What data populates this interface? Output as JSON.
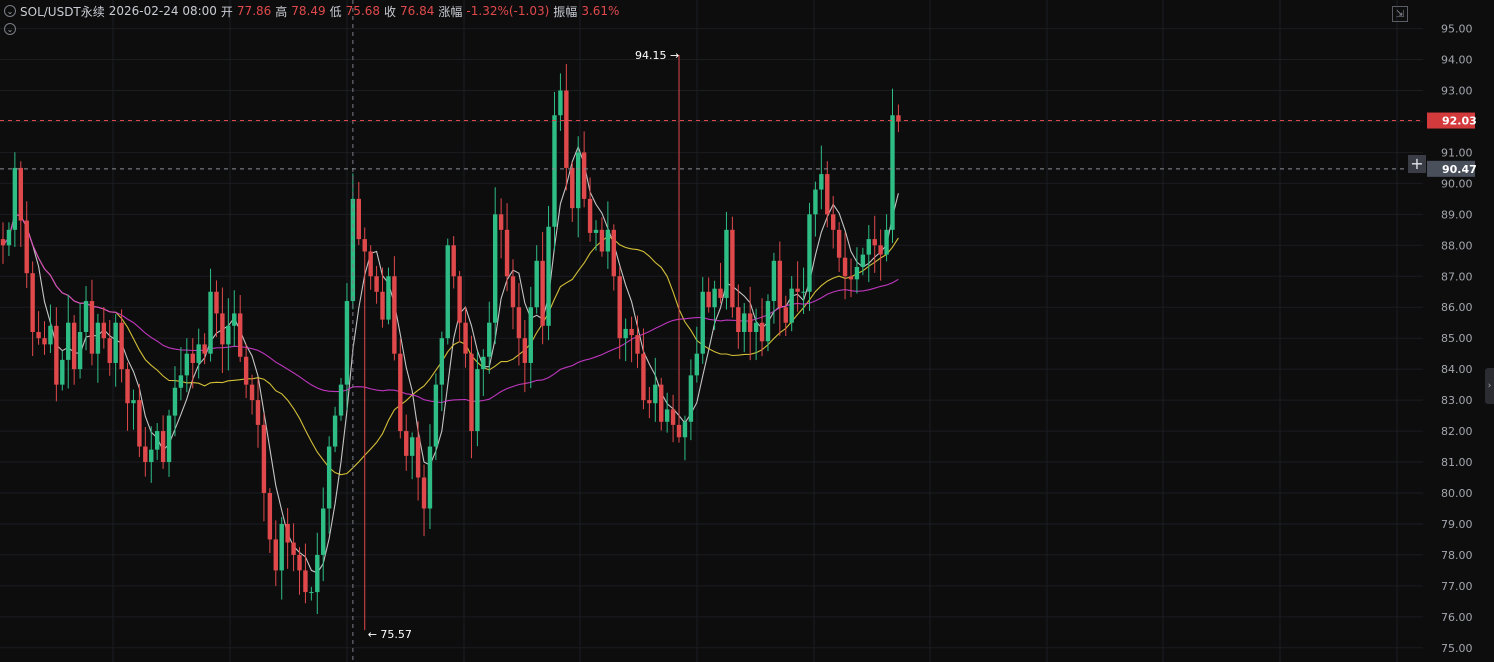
{
  "header": {
    "symbol": "SOL/USDT永续",
    "datetime": "2026-02-24 08:00",
    "open_label": "开",
    "open_value": "77.86",
    "high_label": "高",
    "high_value": "78.49",
    "low_label": "低",
    "low_value": "75.68",
    "close_label": "收",
    "close_value": "76.84",
    "change_label": "涨幅",
    "change_value": "-1.32%(-1.03)",
    "amplitude_label": "振幅",
    "amplitude_value": "3.61%"
  },
  "colors": {
    "background": "#0d0d0e",
    "up": "#2ebd85",
    "down": "#e0494b",
    "ma_fast": "#d8d8d8",
    "ma_mid": "#e8d23c",
    "ma_slow": "#d13bd1",
    "grid": "#1c1d21",
    "axis_text": "#a3a6ad"
  },
  "chart_data": {
    "type": "candlestick",
    "ylim": [
      74.8,
      95.6
    ],
    "y_ticks": [
      "95.00",
      "94.00",
      "93.00",
      "92.00",
      "91.00",
      "90.00",
      "89.00",
      "88.00",
      "87.00",
      "86.00",
      "85.00",
      "84.00",
      "83.00",
      "82.00",
      "81.00",
      "80.00",
      "79.00",
      "78.00",
      "77.00",
      "76.00",
      "75.00"
    ],
    "price_markers": [
      {
        "label": "92.03",
        "value": 92.03,
        "kind": "last-price"
      },
      {
        "label": "90.47",
        "value": 90.47,
        "kind": "crosshair"
      }
    ],
    "annotations": [
      {
        "label": "94.15",
        "value": 94.15,
        "candle": 114,
        "direction": "right"
      },
      {
        "label": "75.57",
        "value": 75.57,
        "candle": 61,
        "direction": "left"
      }
    ],
    "crosshair_candle": 59,
    "closes": [
      88.0,
      88.5,
      90.5,
      88.8,
      87.1,
      85.2,
      85.0,
      84.8,
      85.4,
      83.5,
      84.3,
      85.5,
      84.0,
      85.2,
      86.2,
      84.5,
      85.5,
      85.0,
      84.2,
      85.5,
      84.0,
      82.9,
      83.0,
      81.5,
      81.0,
      81.4,
      82.0,
      81.0,
      82.5,
      83.4,
      83.8,
      84.5,
      84.2,
      84.8,
      84.5,
      86.5,
      85.8,
      84.8,
      85.4,
      85.8,
      84.4,
      83.5,
      83.0,
      82.2,
      80.0,
      78.5,
      77.5,
      79.0,
      78.4,
      78.0,
      77.5,
      76.8,
      76.8,
      78.0,
      79.5,
      81.5,
      82.5,
      83.5,
      86.2,
      89.5,
      88.2,
      87.8,
      87.0,
      86.5,
      85.6,
      87.0,
      84.5,
      82.0,
      81.2,
      81.8,
      80.5,
      79.5,
      81.5,
      83.5,
      85.0,
      88.0,
      87.0,
      85.5,
      84.5,
      82.0,
      84.0,
      84.4,
      85.5,
      89.0,
      88.5,
      87.0,
      86.0,
      85.0,
      84.2,
      86.0,
      87.5,
      85.4,
      88.6,
      92.2,
      93.0,
      90.5,
      89.2,
      91.0,
      89.5,
      88.4,
      88.5,
      87.8,
      88.5,
      87.0,
      85.0,
      85.3,
      85.1,
      84.5,
      83.0,
      82.9,
      83.5,
      82.3,
      82.7,
      82.2,
      81.8,
      82.3,
      83.8,
      84.5,
      86.5,
      86.0,
      86.6,
      86.3,
      88.5,
      86.0,
      85.2,
      85.8,
      85.2,
      85.5,
      84.9,
      86.2,
      87.5,
      86.0,
      85.5,
      86.6,
      86.5,
      86.5,
      89.0,
      89.8,
      90.3,
      89.0,
      88.5,
      87.6,
      87.0,
      86.9,
      87.3,
      87.7,
      88.2,
      88.0,
      87.7,
      88.5,
      92.2,
      92.0
    ],
    "opens": [
      88.2,
      88.0,
      88.5,
      90.5,
      88.8,
      87.1,
      85.2,
      85.0,
      84.8,
      85.4,
      83.5,
      84.3,
      85.5,
      84.0,
      85.2,
      86.2,
      84.5,
      85.5,
      85.0,
      84.2,
      85.5,
      84.0,
      82.9,
      83.0,
      81.5,
      81.0,
      81.4,
      82.0,
      81.0,
      82.5,
      83.4,
      83.8,
      84.5,
      84.2,
      84.8,
      84.5,
      86.5,
      85.8,
      84.8,
      85.4,
      85.8,
      84.4,
      83.5,
      83.0,
      82.2,
      80.0,
      78.5,
      77.5,
      79.0,
      78.4,
      78.0,
      77.5,
      76.8,
      76.8,
      78.0,
      79.5,
      81.5,
      82.5,
      83.5,
      86.2,
      89.5,
      88.2,
      87.8,
      87.0,
      86.5,
      85.6,
      87.0,
      84.5,
      82.0,
      81.2,
      81.8,
      80.5,
      79.5,
      81.5,
      83.5,
      85.0,
      88.0,
      87.0,
      85.5,
      84.5,
      82.0,
      84.0,
      84.4,
      85.5,
      89.0,
      88.5,
      87.0,
      86.0,
      85.0,
      84.2,
      86.0,
      87.5,
      85.4,
      88.6,
      92.2,
      93.0,
      90.5,
      89.2,
      91.0,
      89.5,
      88.4,
      88.5,
      87.8,
      88.5,
      87.0,
      85.0,
      85.3,
      85.1,
      84.5,
      83.0,
      82.9,
      83.5,
      82.3,
      82.7,
      82.2,
      81.8,
      82.3,
      83.8,
      84.5,
      86.5,
      86.0,
      86.6,
      86.3,
      88.5,
      86.0,
      85.2,
      85.8,
      85.2,
      85.5,
      84.9,
      86.2,
      87.5,
      86.0,
      85.5,
      86.6,
      86.5,
      86.5,
      89.0,
      89.8,
      90.3,
      89.0,
      88.5,
      87.6,
      87.0,
      86.9,
      87.3,
      87.7,
      88.2,
      88.0,
      87.7,
      88.5,
      92.2
    ]
  }
}
